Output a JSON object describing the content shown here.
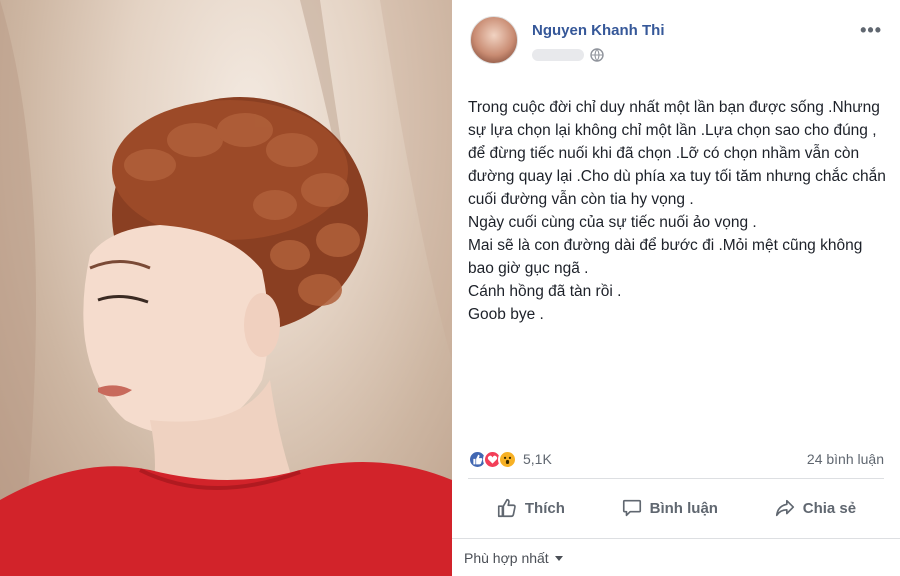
{
  "post": {
    "author": "Nguyen Khanh Thi",
    "more_icon": "•••",
    "paragraphs": [
      "Trong cuộc đời chỉ duy nhất một lần bạn được sống .Nhưng sự lựa chọn lại không chỉ một lần .Lựa chọn sao cho đúng , để đừng tiếc nuối khi đã chọn .Lỡ có chọn nhầm vẫn còn đường quay lại .Cho dù phía xa tuy tối tăm nhưng chắc chắn cuối đường vẫn còn tia hy vọng .",
      "Ngày cuối cùng của sự tiếc nuối ảo vọng .",
      "Mai sẽ là con đường dài để bước đi .Mỏi mệt cũng không bao giờ gục ngã .",
      "Cánh hồng đã tàn rồi .",
      "Goob bye ."
    ],
    "reaction_count": "5,1K",
    "comment_count": "24 bình luận",
    "actions": {
      "like": "Thích",
      "comment": "Bình luận",
      "share": "Chia sẻ"
    },
    "sort_label": "Phù hợp nhất",
    "icons": [
      "globe-icon",
      "like-reaction-icon",
      "love-reaction-icon",
      "wow-reaction-icon",
      "thumbs-up-icon",
      "comment-icon",
      "share-icon"
    ]
  },
  "colors": {
    "link": "#365899",
    "like": "#4267b2",
    "love": "#f33e58",
    "wow": "#f7b125",
    "text": "#1d2129",
    "muted": "#606770"
  }
}
